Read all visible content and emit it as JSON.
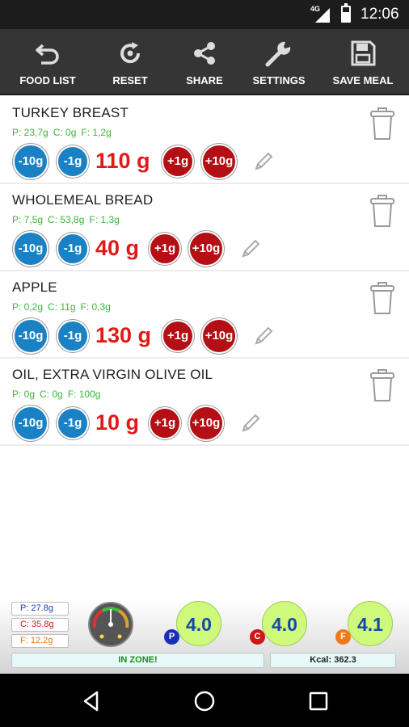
{
  "status_bar": {
    "network": "4G",
    "time": "12:06"
  },
  "toolbar": {
    "items": [
      {
        "label": "FOOD LIST",
        "icon": "undo-arrow-icon"
      },
      {
        "label": "RESET",
        "icon": "reset-icon"
      },
      {
        "label": "SHARE",
        "icon": "share-icon"
      },
      {
        "label": "SETTINGS",
        "icon": "wrench-icon"
      },
      {
        "label": "SAVE MEAL",
        "icon": "floppy-disk-icon"
      }
    ]
  },
  "foods": [
    {
      "name": "TURKEY BREAST",
      "protein": "P: 23,7g",
      "carbs": "C: 0g",
      "fat": "F: 1,2g",
      "quantity": "110 g"
    },
    {
      "name": "WHOLEMEAL BREAD",
      "protein": "P: 7,5g",
      "carbs": "C: 53,8g",
      "fat": "F: 1,3g",
      "quantity": "40 g"
    },
    {
      "name": "APPLE",
      "protein": "P: 0,2g",
      "carbs": "C: 11g",
      "fat": "F: 0,3g",
      "quantity": "130 g"
    },
    {
      "name": "OIL, EXTRA VIRGIN OLIVE OIL",
      "protein": "P: 0g",
      "carbs": "C: 0g",
      "fat": "F: 100g",
      "quantity": "10 g"
    }
  ],
  "buttons": {
    "minus10": "-10g",
    "minus1": "-1g",
    "plus1": "+1g",
    "plus10": "+10g"
  },
  "summary": {
    "protein_total": "P: 27.8g",
    "carbs_total": "C: 35.8g",
    "fat_total": "F: 12.2g",
    "protein_score": "4.0",
    "carbs_score": "4.0",
    "fat_score": "4.1",
    "protein_tag": "P",
    "carbs_tag": "C",
    "fat_tag": "F",
    "zone_status": "IN ZONE!",
    "kcal": "Kcal: 362.3"
  },
  "colors": {
    "accent_blue": "#1a82c4",
    "accent_red": "#b40f14",
    "quantity_red": "#e31818",
    "macro_green": "#3cb53c",
    "score_green": "#cff97a"
  }
}
